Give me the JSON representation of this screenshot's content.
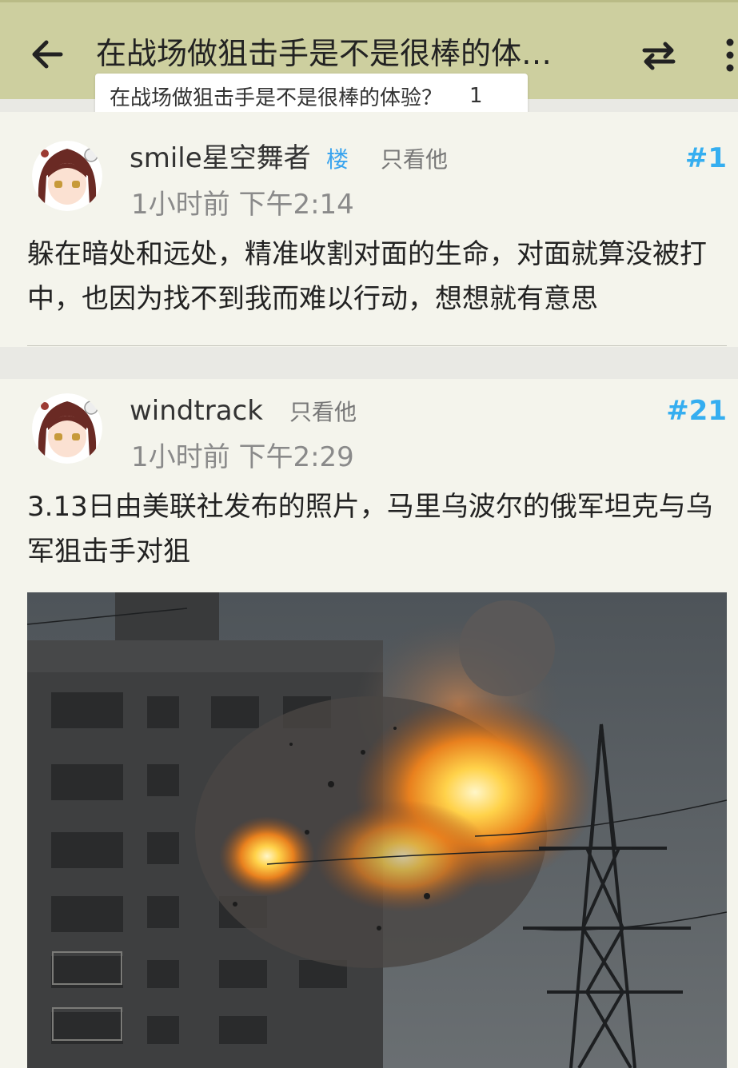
{
  "header": {
    "title": "在战场做狙击手是不是很棒的体…",
    "tooltip_title": "在战场做狙击手是不是很棒的体验？",
    "tooltip_count": "1",
    "back_icon": "arrow-left-icon",
    "swap_icon": "swap-arrows-icon",
    "more_icon": "vertical-dots-icon"
  },
  "posts": [
    {
      "username": "smile星空舞者",
      "op_badge": "楼",
      "only_him": "只看他",
      "floor": "#1",
      "time": "1小时前  下午2:14",
      "content": "躲在暗处和远处，精准收割对面的生命，对面就算没被打中，也因为找不到我而难以行动，想想就有意思"
    },
    {
      "username": "windtrack",
      "only_him": "只看他",
      "floor": "#21",
      "time": "1小时前  下午2:29",
      "content": "3.13日由美联社发布的照片，马里乌波尔的俄军坦克与乌军狙击手对狙"
    }
  ],
  "colors": {
    "header_bg": "#cdcf9f",
    "post_bg": "#f4f4ec",
    "floor_accent": "#35aef0"
  }
}
